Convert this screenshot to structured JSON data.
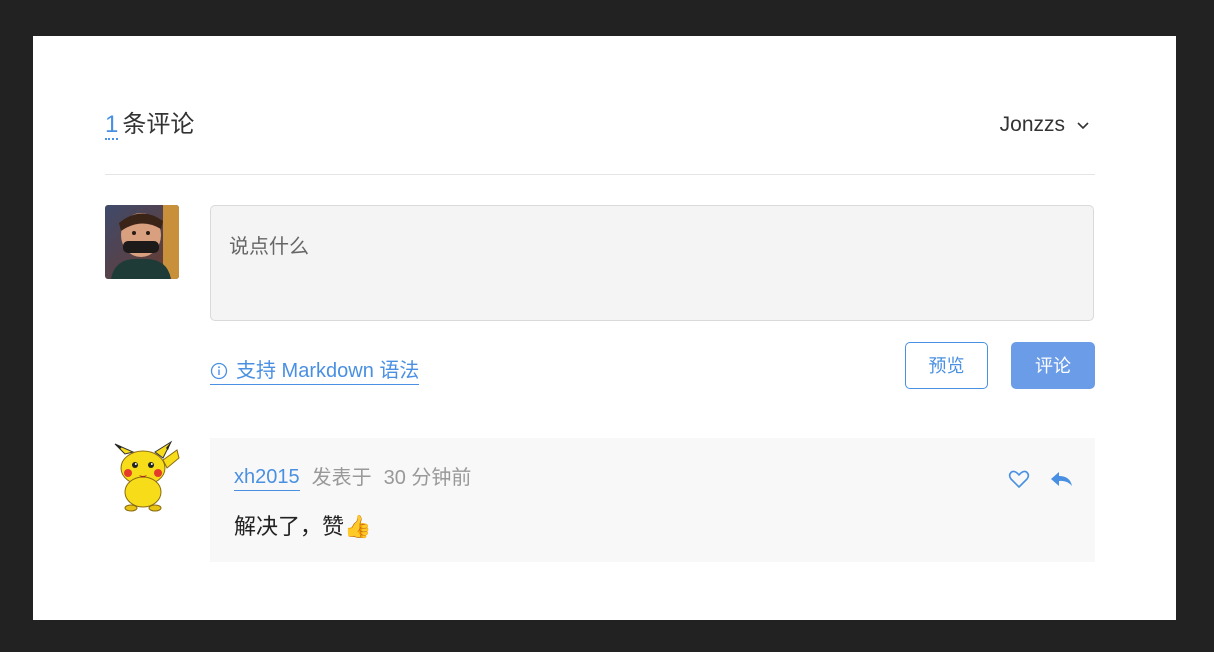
{
  "header": {
    "count": "1",
    "count_label": "条评论",
    "username": "Jonzzs"
  },
  "editor": {
    "placeholder": "说点什么",
    "markdown_link": "支持 Markdown 语法",
    "preview_label": "预览",
    "submit_label": "评论"
  },
  "comments": [
    {
      "author": "xh2015",
      "posted_label": "发表于",
      "time": "30 分钟前",
      "body": "解决了，赞👍"
    }
  ],
  "colors": {
    "accent": "#4a90e2",
    "submit_bg": "#6b9ce8"
  }
}
